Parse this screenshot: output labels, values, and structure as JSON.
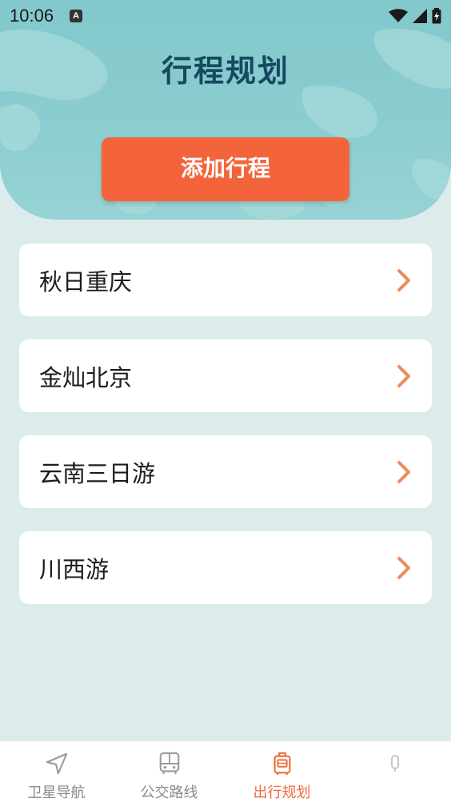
{
  "status_bar": {
    "time": "10:06",
    "notification_glyph": "A"
  },
  "header": {
    "title": "行程规划"
  },
  "add_button": {
    "label": "添加行程"
  },
  "trips": [
    {
      "label": "秋日重庆"
    },
    {
      "label": "金灿北京"
    },
    {
      "label": "云南三日游"
    },
    {
      "label": "川西游"
    }
  ],
  "tabbar": {
    "tabs": [
      {
        "label": "卫星导航",
        "icon": "navigation-arrow-icon",
        "active": false
      },
      {
        "label": "公交路线",
        "icon": "bus-icon",
        "active": false
      },
      {
        "label": "出行规划",
        "icon": "luggage-icon",
        "active": true
      },
      {
        "label": "",
        "icon": "mic-icon",
        "active": false
      }
    ]
  },
  "colors": {
    "accent": "#f4643a",
    "title": "#164a5e",
    "header_bg": "#87cbcf",
    "page_bg": "#dcecec",
    "tab_active": "#ef6a3a",
    "tab_inactive": "#8a8a8a"
  }
}
